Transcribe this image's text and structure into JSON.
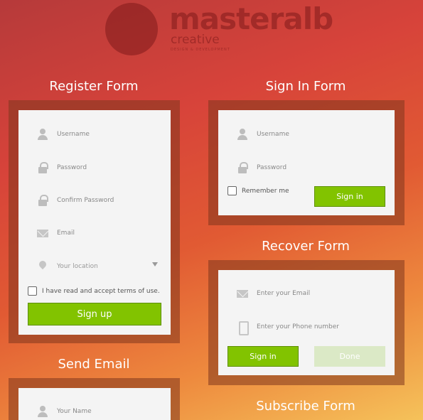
{
  "brand": {
    "name": "masteralb",
    "subtitle": "creative",
    "tagline": "DESIGN & DEVELOPMENT"
  },
  "register": {
    "title": "Register Form",
    "username_placeholder": "Username",
    "password_placeholder": "Password",
    "confirm_placeholder": "Confirm Password",
    "email_placeholder": "Email",
    "location_placeholder": "Your location",
    "terms_label": "I have read and accept terms of use.",
    "submit_label": "Sign up"
  },
  "signin": {
    "title": "Sign In Form",
    "username_placeholder": "Username",
    "password_placeholder": "Password",
    "remember_label": "Remember me",
    "submit_label": "Sign in"
  },
  "recover": {
    "title": "Recover Form",
    "email_placeholder": "Enter your Email",
    "phone_placeholder": "Enter your Phone number",
    "signin_label": "Sign in",
    "done_label": "Done"
  },
  "send_email": {
    "title": "Send Email",
    "name_placeholder": "Your Name"
  },
  "subscribe": {
    "title": "Subscribe Form"
  },
  "colors": {
    "accent_green": "#82c300",
    "bg_top": "#b63a3a",
    "bg_bottom": "#f5c25a"
  }
}
